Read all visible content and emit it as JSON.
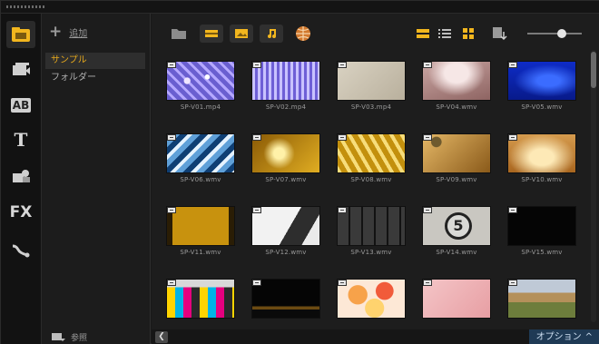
{
  "sidebar": {
    "rail": [
      {
        "name": "media",
        "glyph": ""
      },
      {
        "name": "instant-project",
        "glyph": ""
      },
      {
        "name": "transition",
        "glyph": "AB"
      },
      {
        "name": "title",
        "glyph": "T"
      },
      {
        "name": "graphic",
        "glyph": ""
      },
      {
        "name": "filter",
        "glyph": "FX"
      },
      {
        "name": "path",
        "glyph": ""
      }
    ]
  },
  "library": {
    "add_label": "追加",
    "items": [
      "サンプル",
      "フォルダー"
    ],
    "browse_label": "参照"
  },
  "grid": {
    "tiles": [
      {
        "label": "SP-V01.mp4"
      },
      {
        "label": "SP-V02.mp4"
      },
      {
        "label": "SP-V03.mp4"
      },
      {
        "label": "SP-V04.wmv"
      },
      {
        "label": "SP-V05.wmv"
      },
      {
        "label": "SP-V06.wmv"
      },
      {
        "label": "SP-V07.wmv"
      },
      {
        "label": "SP-V08.wmv"
      },
      {
        "label": "SP-V09.wmv"
      },
      {
        "label": "SP-V10.wmv"
      },
      {
        "label": "SP-V11.wmv"
      },
      {
        "label": "SP-V12.wmv"
      },
      {
        "label": "SP-V13.wmv"
      },
      {
        "label": "SP-V14.wmv"
      },
      {
        "label": "SP-V15.wmv"
      },
      {
        "label": ""
      },
      {
        "label": ""
      },
      {
        "label": ""
      },
      {
        "label": ""
      },
      {
        "label": ""
      }
    ],
    "countdown_digit": "5"
  },
  "footer": {
    "options_label": "オプション",
    "options_arrow": "^"
  },
  "colors": {
    "accent": "#e5a81c",
    "options_bg": "#1f3a55"
  }
}
